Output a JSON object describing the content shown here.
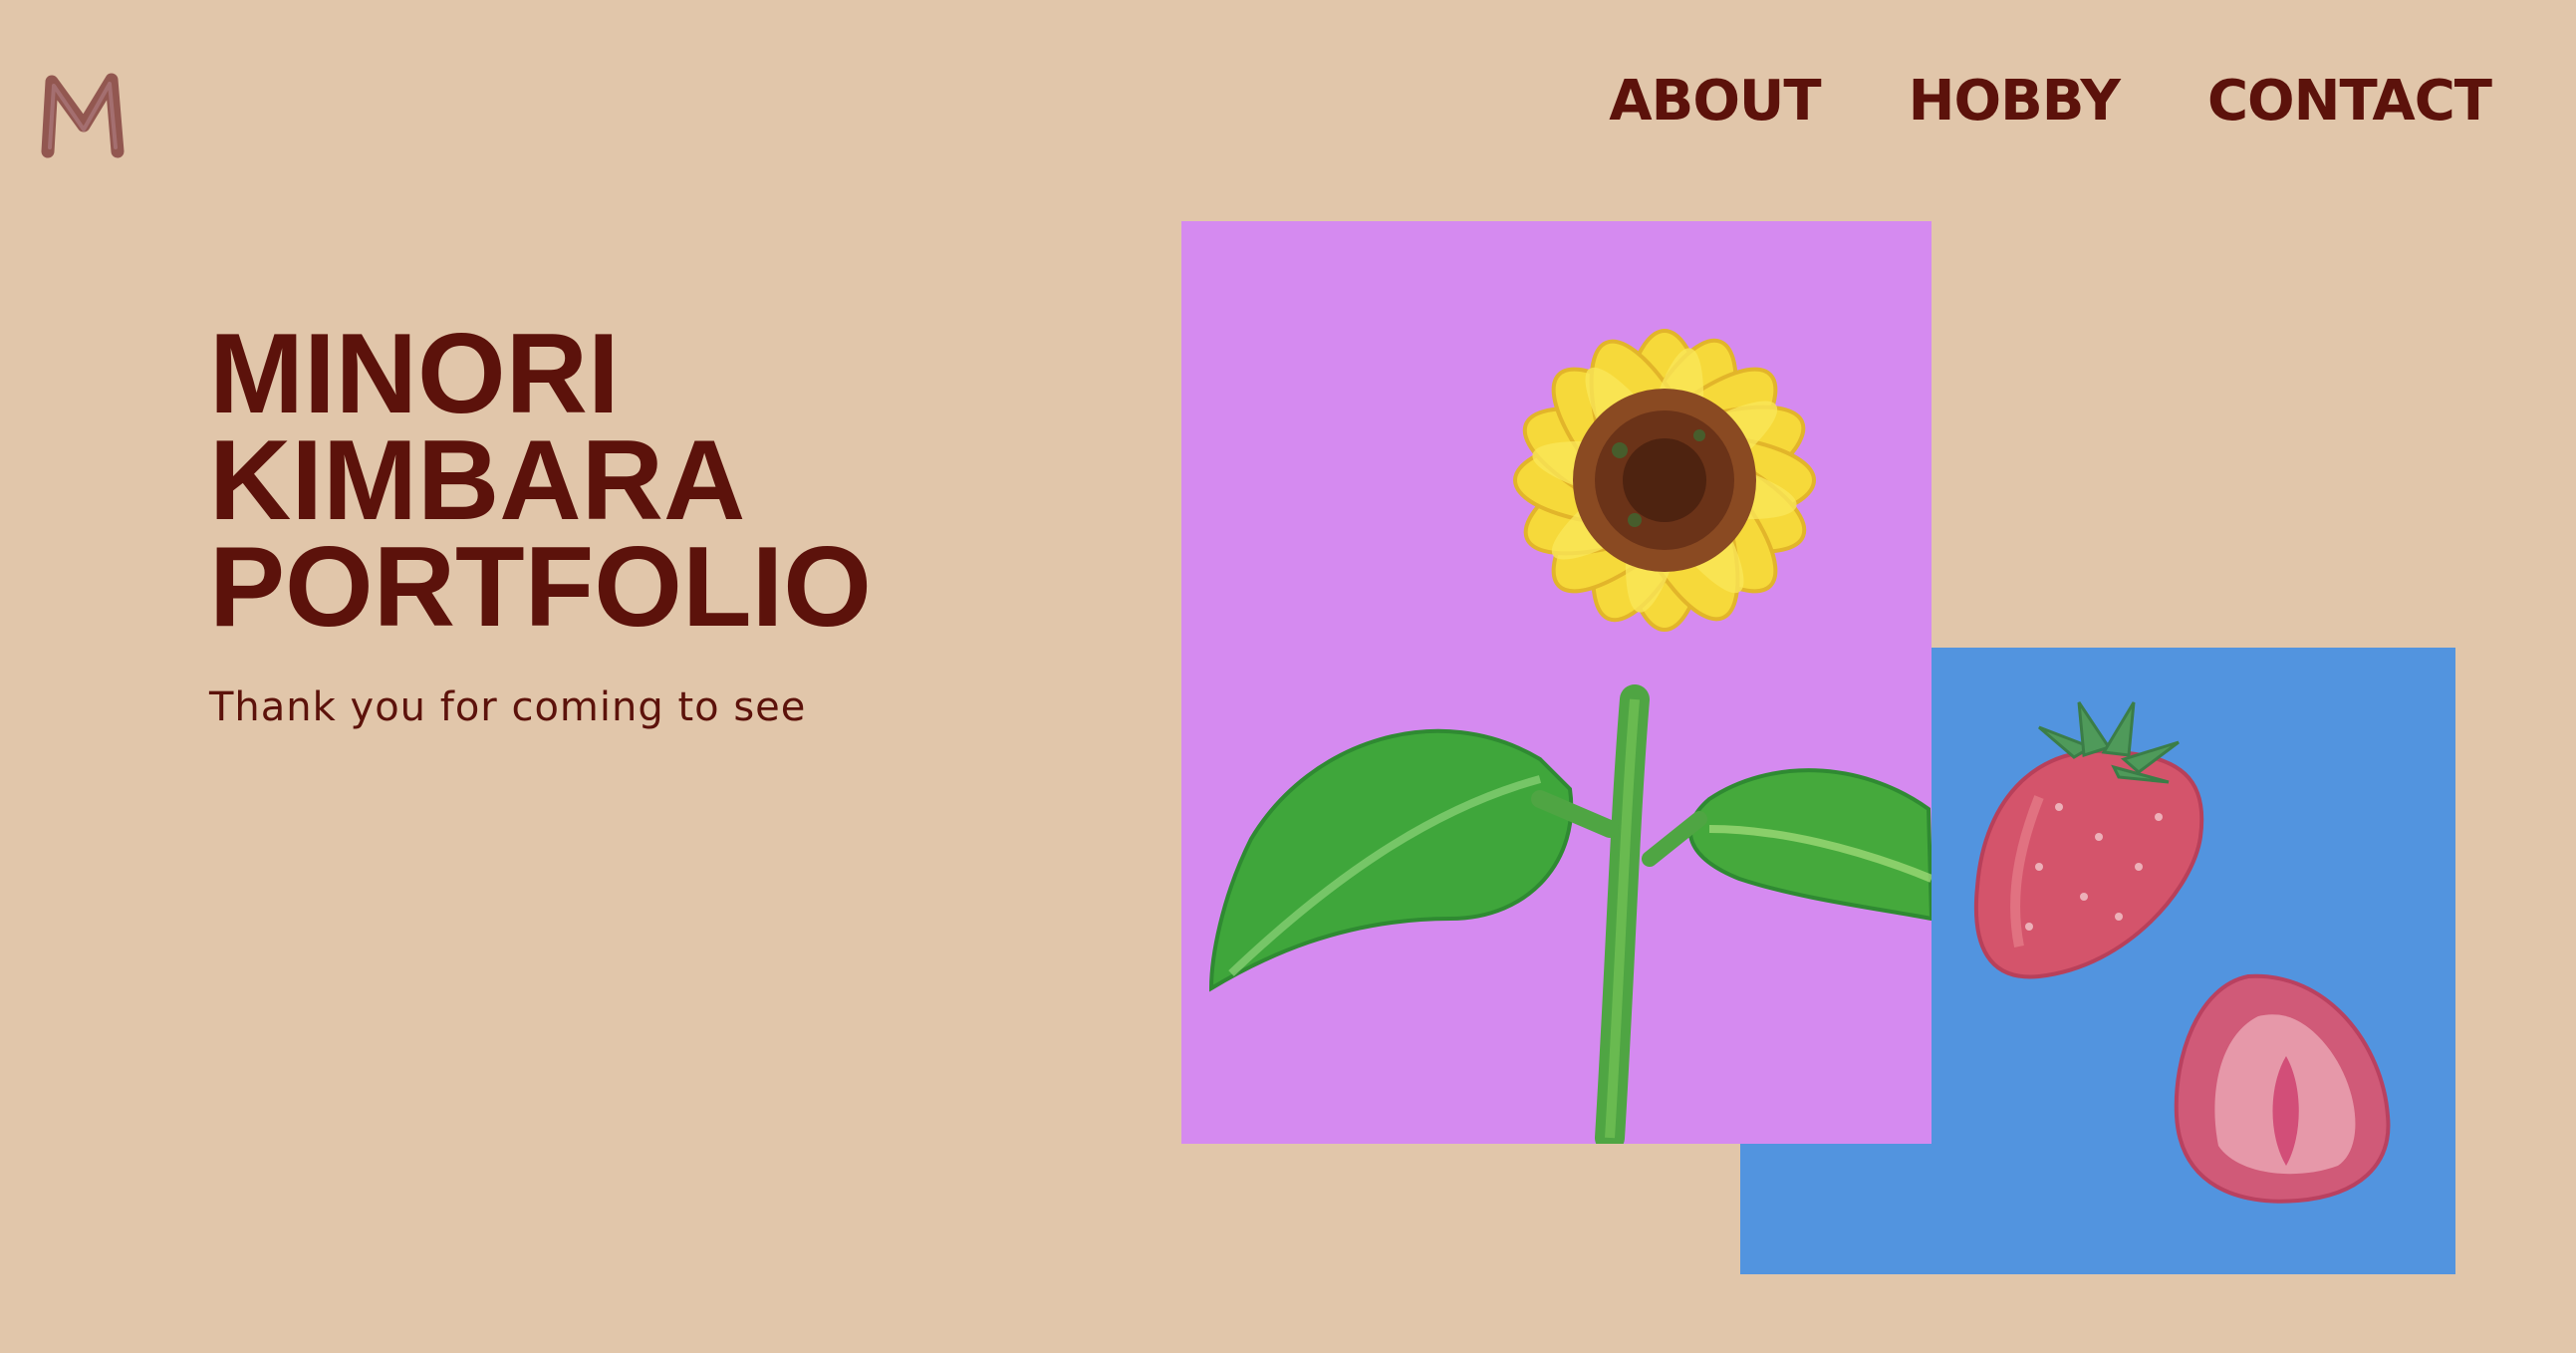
{
  "logo": {
    "letter": "M",
    "icon": "crayon-m-logo-icon"
  },
  "nav": {
    "items": [
      {
        "label": "ABOUT"
      },
      {
        "label": "HOBBY"
      },
      {
        "label": "CONTACT"
      }
    ]
  },
  "hero": {
    "title_lines": [
      "MINORI",
      "KIMBARA",
      "PORTFOLIO"
    ],
    "subtitle": "Thank you for coming to see"
  },
  "artworks": [
    {
      "subject": "sunflower",
      "background": "#d58af0"
    },
    {
      "subject": "strawberries",
      "background": "#5294df"
    }
  ],
  "colors": {
    "page_background": "#e1c6aa",
    "text_brand": "#5c120b"
  }
}
